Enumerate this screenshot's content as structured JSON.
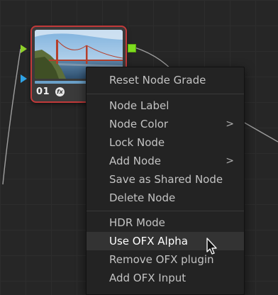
{
  "node": {
    "number": "01",
    "fx_badge": "fx",
    "border_color": "#c23a3a",
    "progress_color": "#6aa0c8",
    "input_ports": [
      "green-arrow",
      "blue-arrow"
    ],
    "output_port_color": "#7ddc1f"
  },
  "menu": {
    "groups": [
      [
        {
          "label": "Reset Node Grade"
        }
      ],
      [
        {
          "label": "Node Label"
        },
        {
          "label": "Node Color",
          "submenu": true,
          "icon": "chevron-right-icon",
          "chevron": ">"
        },
        {
          "label": "Lock Node"
        },
        {
          "label": "Add Node",
          "submenu": true,
          "icon": "chevron-right-icon",
          "chevron": ">"
        },
        {
          "label": "Save as Shared Node"
        },
        {
          "label": "Delete Node"
        }
      ],
      [
        {
          "label": "HDR Mode"
        },
        {
          "label": "Use OFX Alpha",
          "highlighted": true
        },
        {
          "label": "Remove OFX plugin"
        },
        {
          "label": "Add OFX Input"
        }
      ]
    ]
  },
  "cursor": {
    "icon": "pointer-cursor-icon"
  }
}
